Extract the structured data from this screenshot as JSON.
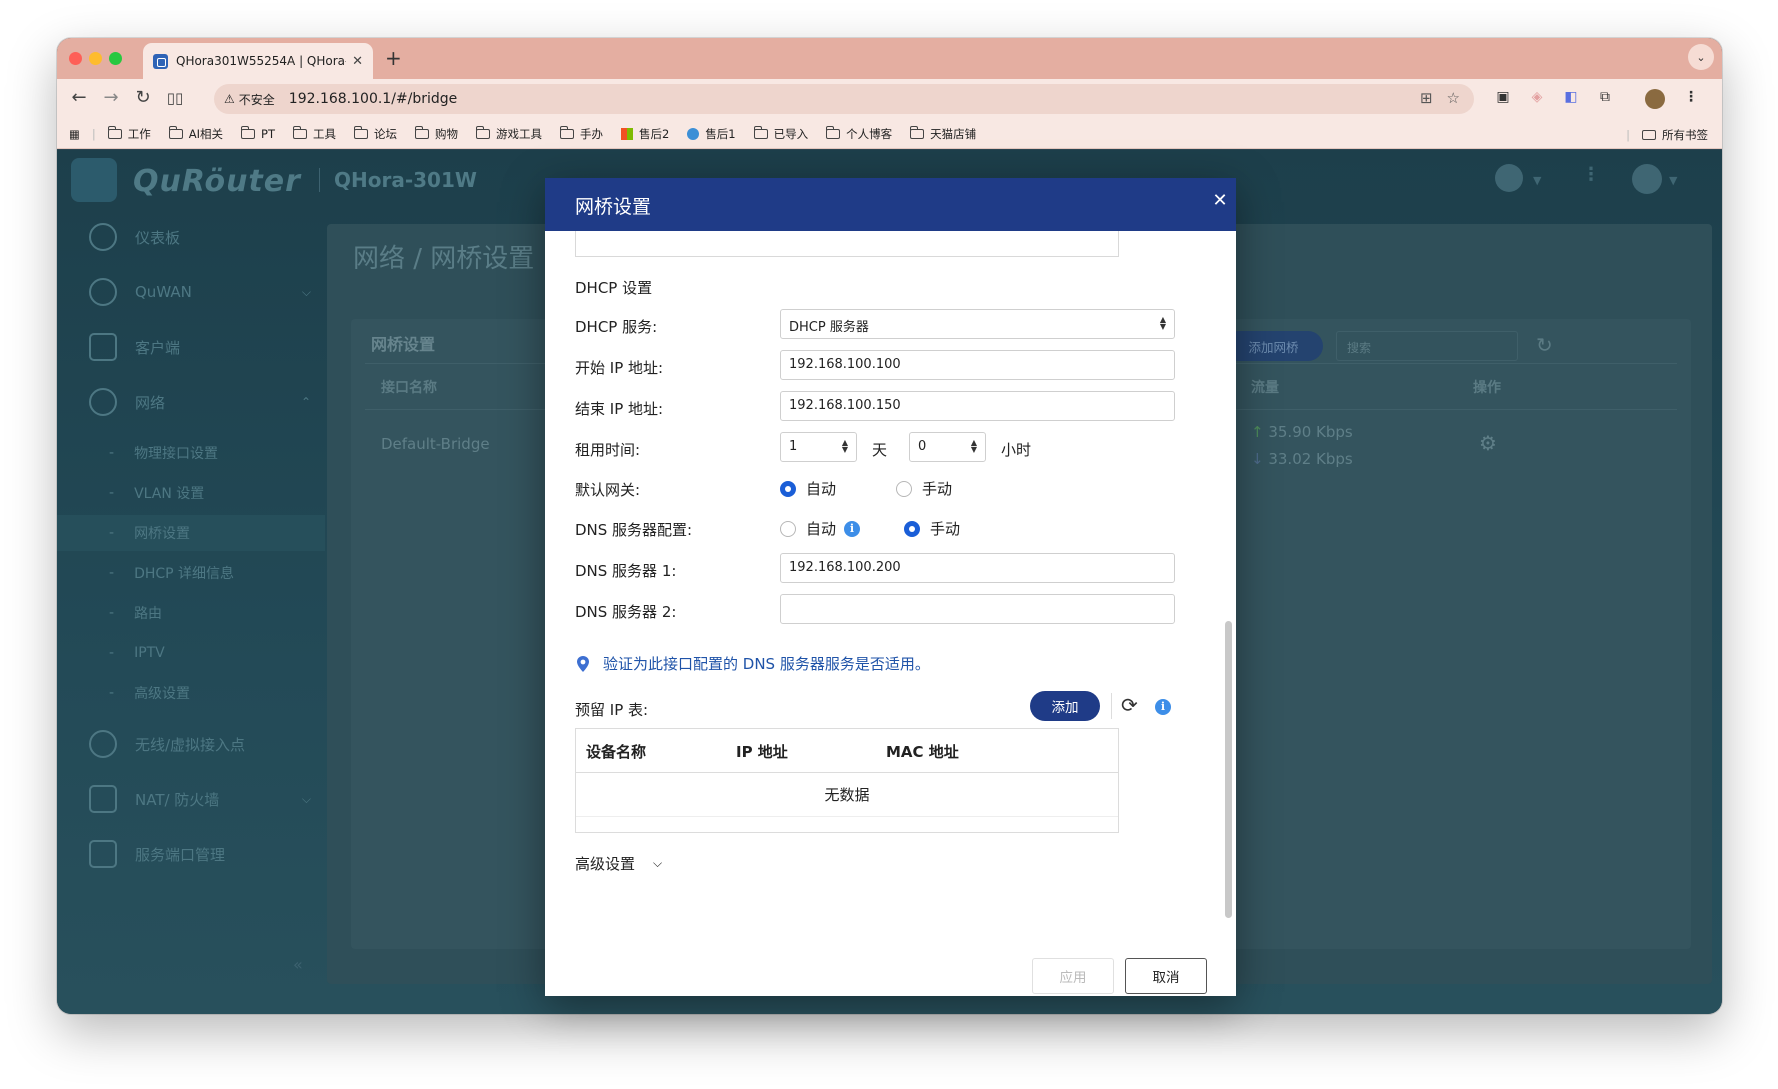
{
  "browser": {
    "tab_title": "QHora301W55254A | QHora-",
    "tab_close": "✕",
    "new_tab": "+",
    "tab_menu": "⌄",
    "insecure_label": "不安全",
    "url": "192.168.100.1/#/bridge",
    "bookmarks": [
      "工作",
      "AI相关",
      "PT",
      "工具",
      "论坛",
      "购物",
      "游戏工具",
      "手办",
      "售后2",
      "售后1",
      "已导入",
      "个人博客",
      "天猫店铺"
    ],
    "all_bookmarks": "所有书签",
    "traffic_colors": [
      "#fe5f57",
      "#febc2e",
      "#28c840"
    ]
  },
  "app": {
    "brand": "QuRöuter",
    "model": "QHora-301W",
    "page_title": "网络 / 网桥设置",
    "sidebar": {
      "items": [
        {
          "label": "仪表板"
        },
        {
          "label": "QuWAN"
        },
        {
          "label": "客户端"
        },
        {
          "label": "网络"
        },
        {
          "label": "无线/虚拟接入点"
        },
        {
          "label": "NAT/ 防火墙"
        },
        {
          "label": "服务端口管理"
        }
      ],
      "subitems": [
        "物理接口设置",
        "VLAN 设置",
        "网桥设置",
        "DHCP 详细信息",
        "路由",
        "IPTV",
        "高级设置"
      ],
      "active_subitem": "网桥设置"
    },
    "card": {
      "title": "网桥设置",
      "add_button": "添加网桥",
      "search_placeholder": "搜索",
      "columns": {
        "name": "接口名称",
        "traffic": "流量",
        "action": "操作"
      },
      "row": {
        "name": "Default-Bridge",
        "up": "35.90 Kbps",
        "down": "33.02 Kbps"
      }
    }
  },
  "modal": {
    "title": "网桥设置",
    "close": "✕",
    "dhcp_section": "DHCP 设置",
    "dhcp_service_label": "DHCP 服务:",
    "dhcp_service_value": "DHCP 服务器",
    "start_ip_label": "开始 IP 地址:",
    "start_ip": "192.168.100.100",
    "end_ip_label": "结束 IP 地址:",
    "end_ip": "192.168.100.150",
    "lease_label": "租用时间:",
    "lease_days": "1",
    "lease_days_unit": "天",
    "lease_hours": "0",
    "lease_hours_unit": "小时",
    "gateway_label": "默认网关:",
    "gateway_auto": "自动",
    "gateway_manual": "手动",
    "gateway_selected": "自动",
    "dns_config_label": "DNS 服务器配置:",
    "dns_auto": "自动",
    "dns_manual": "手动",
    "dns_selected": "手动",
    "dns1_label": "DNS 服务器 1:",
    "dns1": "192.168.100.200",
    "dns2_label": "DNS 服务器 2:",
    "dns2": "",
    "verify_text": "验证为此接口配置的 DNS 服务器服务是否适用。",
    "reserved_label": "预留 IP 表:",
    "add_button": "添加",
    "info_glyph": "i",
    "table_columns": [
      "设备名称",
      "IP 地址",
      "MAC 地址"
    ],
    "no_data": "无数据",
    "advanced": "高级设置",
    "apply": "应用",
    "cancel": "取消"
  }
}
